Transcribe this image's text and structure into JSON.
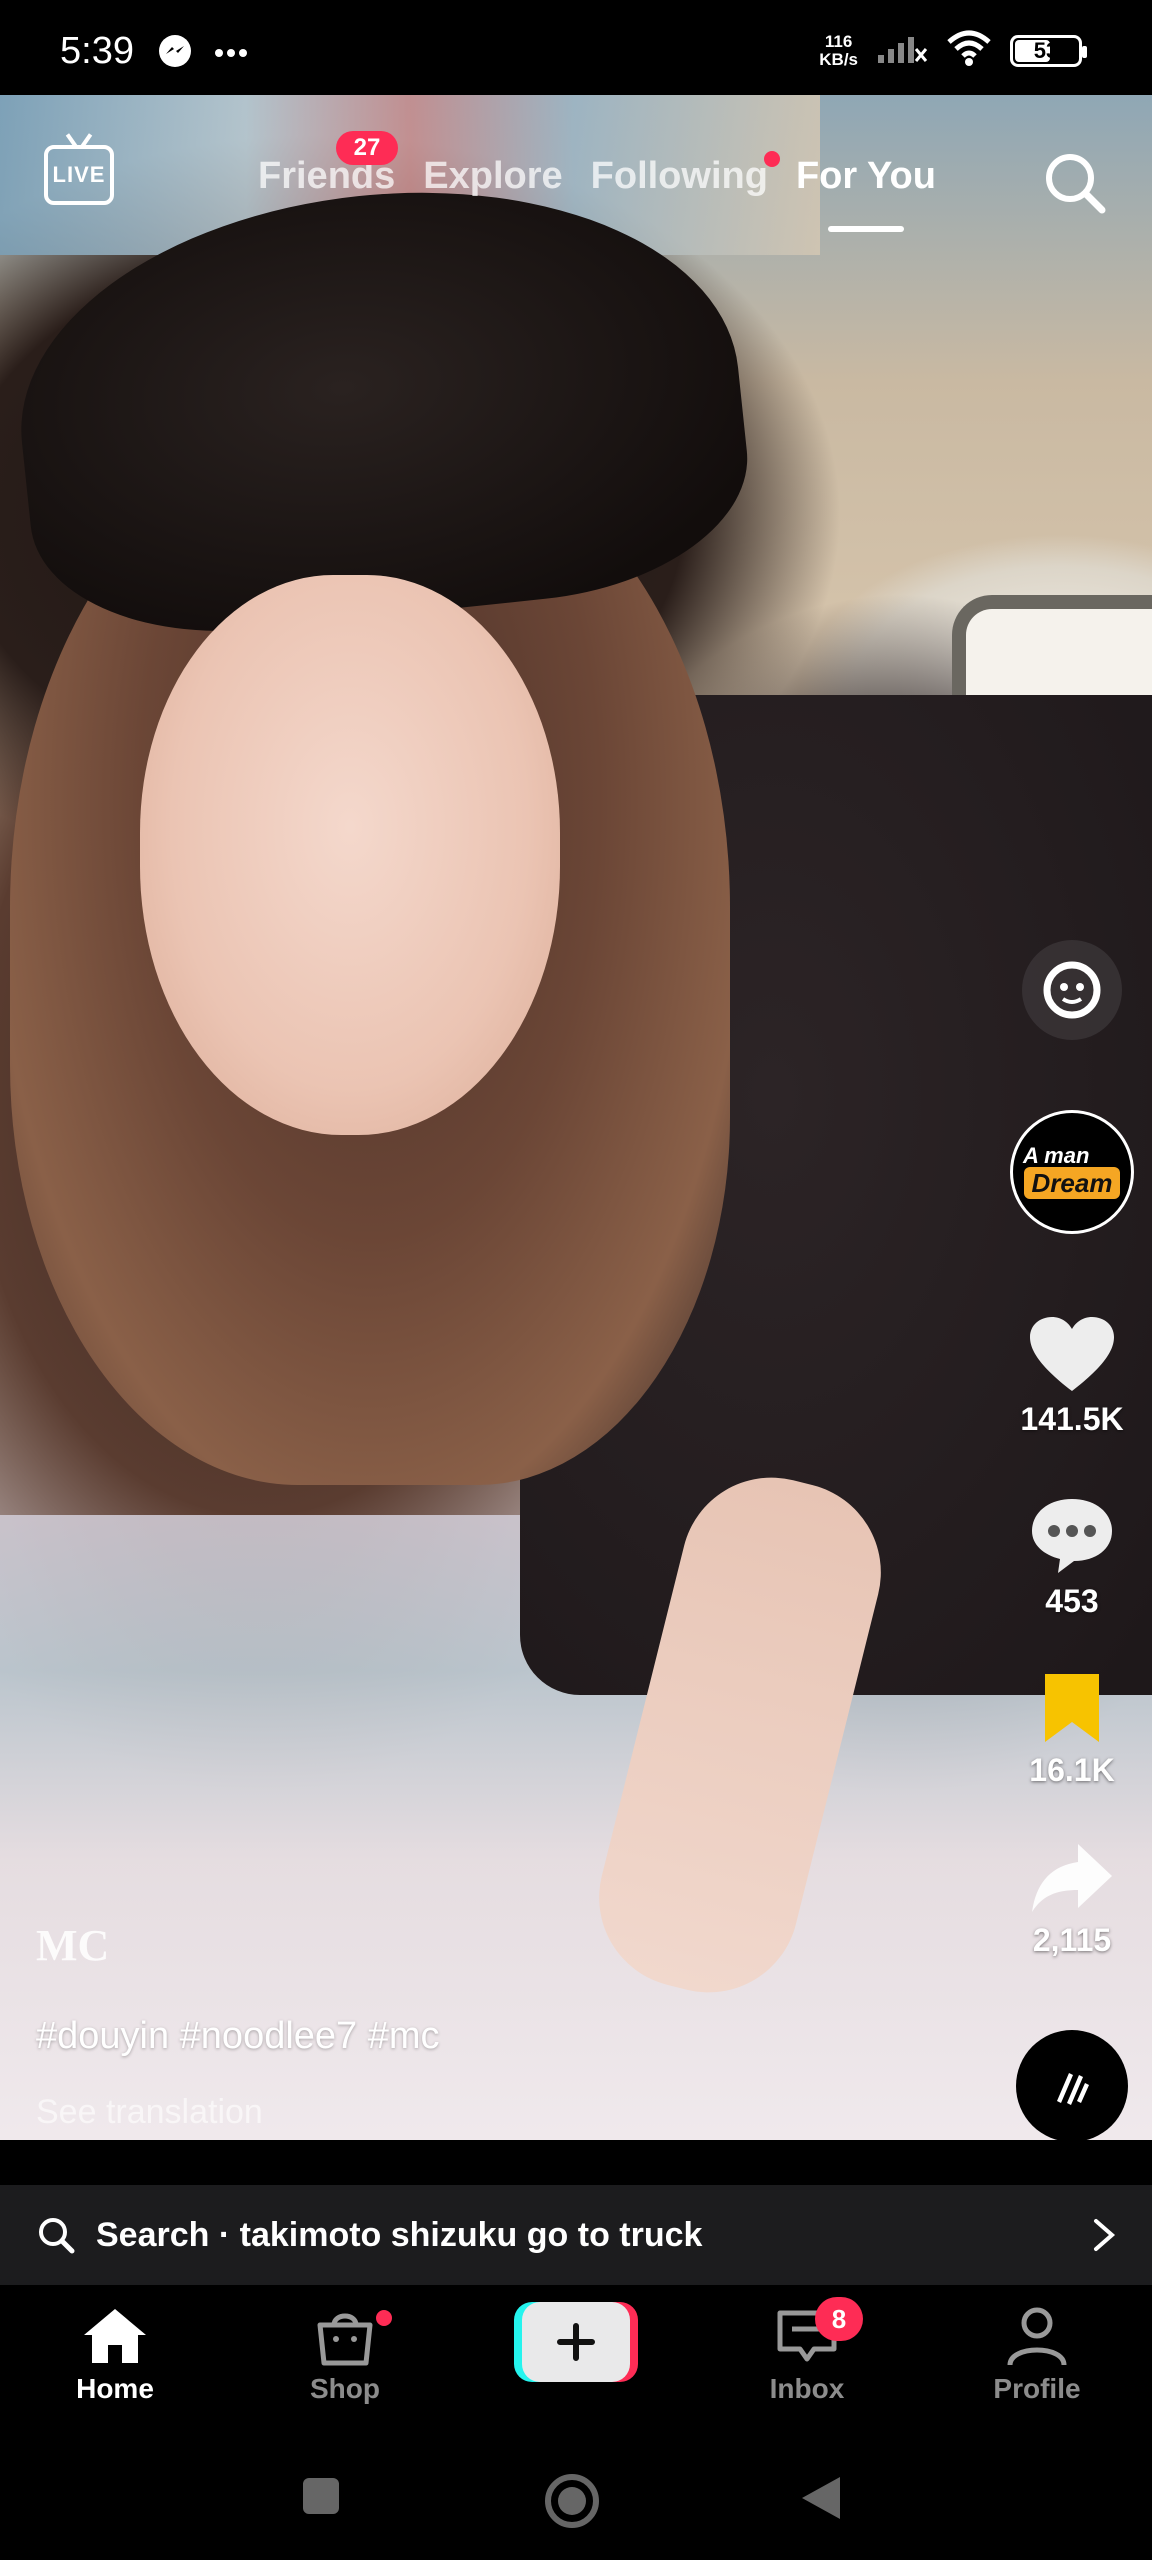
{
  "status_bar": {
    "time": "5:39",
    "net_speed_value": "116",
    "net_speed_unit": "KB/s",
    "battery": "53",
    "battery_level": 0.53
  },
  "top_nav": {
    "live_label": "LIVE",
    "tabs": [
      {
        "label": "Friends",
        "badge": "27"
      },
      {
        "label": "Explore"
      },
      {
        "label": "Following",
        "has_dot": true
      },
      {
        "label": "For You",
        "active": true
      }
    ]
  },
  "right_rail": {
    "avatar_top": "A man",
    "avatar_main": "Dream",
    "likes": "141.5K",
    "comments": "453",
    "saves": "16.1K",
    "shares": "2,115"
  },
  "caption": {
    "author": "MC",
    "hashtags": "#douyin #noodlee7 #mc",
    "translate": "See translation"
  },
  "search_bar": {
    "text": "Search · takimoto shizuku go to truck"
  },
  "bottom_nav": {
    "items": [
      {
        "label": "Home",
        "active": true
      },
      {
        "label": "Shop",
        "has_dot": true
      },
      {
        "label": "Inbox",
        "badge": "8"
      },
      {
        "label": "Profile"
      }
    ]
  },
  "colors": {
    "accent": "#fe2c55",
    "create_cyan": "#25f4ee",
    "save_yellow": "#f7c300"
  },
  "icons": [
    "messenger-icon",
    "more-dots-icon",
    "signal-icon",
    "wifi-icon",
    "battery-icon",
    "live-icon",
    "search-icon",
    "filter-face-icon",
    "heart-icon",
    "comment-icon",
    "bookmark-icon",
    "share-icon",
    "music-disc-icon",
    "chevron-right-icon",
    "home-icon",
    "shop-icon",
    "plus-icon",
    "inbox-icon",
    "profile-icon",
    "recents-icon",
    "home-circle-icon",
    "back-icon"
  ]
}
